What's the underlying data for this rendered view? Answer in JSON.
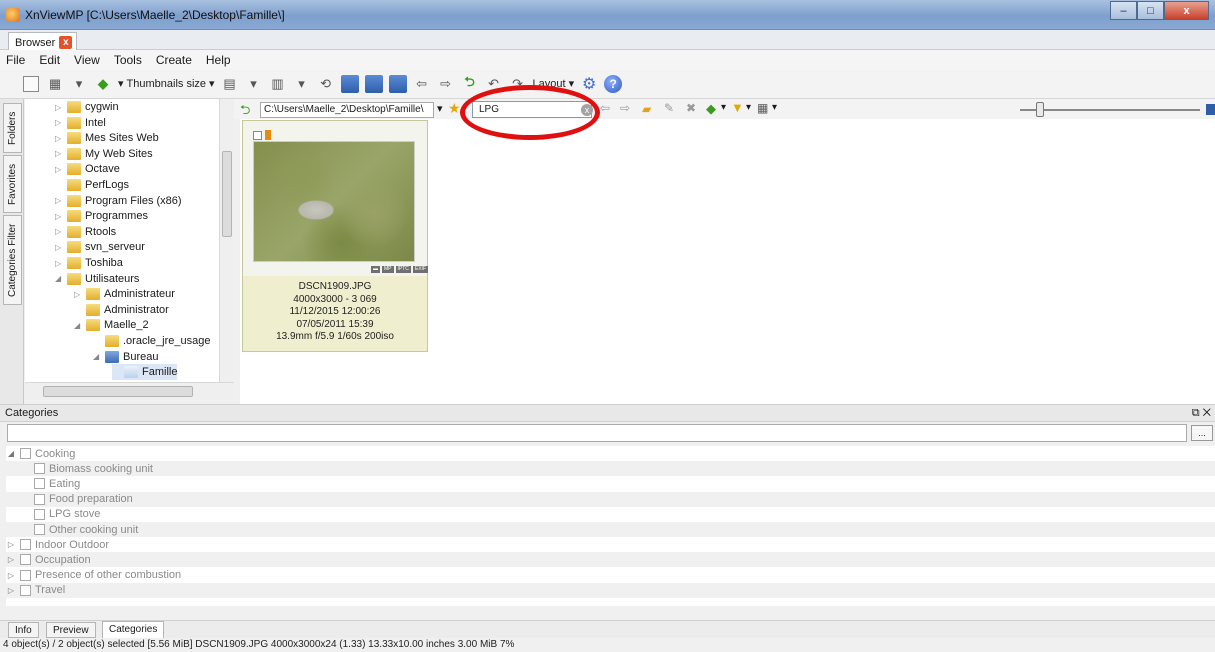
{
  "window": {
    "title": "XnViewMP [C:\\Users\\Maelle_2\\Desktop\\Famille\\]",
    "min": "–",
    "max": "□",
    "close": "x"
  },
  "tabs": {
    "browser": "Browser",
    "close": "x"
  },
  "menu": [
    "File",
    "Edit",
    "View",
    "Tools",
    "Create",
    "Help"
  ],
  "toolbar": {
    "thumbnails_size": "Thumbnails size",
    "layout": "Layout"
  },
  "side_tabs": [
    "Folders",
    "Favorites",
    "Categories Filter"
  ],
  "tree": [
    {
      "label": "cygwin",
      "indent": 1,
      "expander": "collapsed"
    },
    {
      "label": "Intel",
      "indent": 1,
      "expander": "collapsed"
    },
    {
      "label": "Mes Sites Web",
      "indent": 1,
      "expander": "collapsed"
    },
    {
      "label": "My Web Sites",
      "indent": 1,
      "expander": "collapsed"
    },
    {
      "label": "Octave",
      "indent": 1,
      "expander": "collapsed"
    },
    {
      "label": "PerfLogs",
      "indent": 1,
      "expander": "none"
    },
    {
      "label": "Program Files (x86)",
      "indent": 1,
      "expander": "collapsed"
    },
    {
      "label": "Programmes",
      "indent": 1,
      "expander": "collapsed"
    },
    {
      "label": "Rtools",
      "indent": 1,
      "expander": "collapsed"
    },
    {
      "label": "svn_serveur",
      "indent": 1,
      "expander": "collapsed"
    },
    {
      "label": "Toshiba",
      "indent": 1,
      "expander": "collapsed"
    },
    {
      "label": "Utilisateurs",
      "indent": 1,
      "expander": "expanded"
    },
    {
      "label": "Administrateur",
      "indent": 2,
      "expander": "collapsed"
    },
    {
      "label": "Administrator",
      "indent": 2,
      "expander": "none"
    },
    {
      "label": "Maelle_2",
      "indent": 2,
      "expander": "expanded"
    },
    {
      "label": ".oracle_jre_usage",
      "indent": 3,
      "expander": "none"
    },
    {
      "label": "Bureau",
      "indent": 3,
      "expander": "expanded",
      "folder": "blue"
    },
    {
      "label": "Famille",
      "indent": 4,
      "expander": "none",
      "selected": true
    }
  ],
  "nav": {
    "path": "C:\\Users\\Maelle_2\\Desktop\\Famille\\",
    "filter": "LPG",
    "clear": "x"
  },
  "thumb": {
    "badges": [
      "▬",
      "MP",
      "IPTC",
      "EXIF"
    ],
    "info": [
      "DSCN1909.JPG",
      "4000x3000 - 3 069",
      "11/12/2015 12:00:26",
      "07/05/2011 15:39",
      "13.9mm f/5.9 1/60s 200iso"
    ]
  },
  "categories": {
    "title": "Categories",
    "more": "...",
    "items": [
      {
        "label": "Cooking",
        "level": 0,
        "expander": "expanded"
      },
      {
        "label": "Biomass cooking unit",
        "level": 1,
        "expander": "none"
      },
      {
        "label": "Eating",
        "level": 1,
        "expander": "none"
      },
      {
        "label": "Food preparation",
        "level": 1,
        "expander": "none"
      },
      {
        "label": "LPG stove",
        "level": 1,
        "expander": "none"
      },
      {
        "label": "Other cooking unit",
        "level": 1,
        "expander": "none"
      },
      {
        "label": "Indoor Outdoor",
        "level": 0,
        "expander": "collapsed"
      },
      {
        "label": "Occupation",
        "level": 0,
        "expander": "collapsed"
      },
      {
        "label": "Presence of other combustion",
        "level": 0,
        "expander": "collapsed"
      },
      {
        "label": "Travel",
        "level": 0,
        "expander": "collapsed"
      }
    ]
  },
  "bottom_tabs": [
    "Info",
    "Preview",
    "Categories"
  ],
  "status": "4 object(s) / 2 object(s) selected [5.56 MiB]  DSCN1909.JPG  4000x3000x24 (1.33)  13.33x10.00 inches  3.00 MiB  7%"
}
